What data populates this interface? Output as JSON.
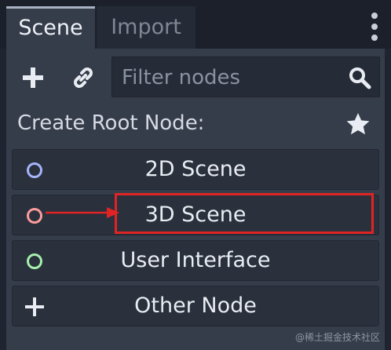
{
  "tabs": [
    {
      "label": "Scene",
      "active": true
    },
    {
      "label": "Import",
      "active": false
    }
  ],
  "toolbar": {
    "add_icon": "plus-icon",
    "link_icon": "link-icon",
    "filter_placeholder": "Filter nodes",
    "search_icon": "search-icon"
  },
  "create_root": {
    "label": "Create Root Node:",
    "favorite_icon": "star-icon"
  },
  "nodes": [
    {
      "label": "2D Scene",
      "icon": "circle-2d-icon",
      "color": "#a5b4fb"
    },
    {
      "label": "3D Scene",
      "icon": "circle-3d-icon",
      "color": "#fc9c9c"
    },
    {
      "label": "User Interface",
      "icon": "circle-ui-icon",
      "color": "#a5efac"
    },
    {
      "label": "Other Node",
      "icon": "plus-icon",
      "color": "#e9edf3"
    }
  ],
  "annotation": {
    "highlight_color": "#e02424",
    "target": "3D Scene"
  },
  "watermark": "@稀土掘金技术社区",
  "colors": {
    "background": "#1e2430",
    "panel": "#363d4a",
    "button": "#2a303c",
    "text": "#e9edf3"
  }
}
